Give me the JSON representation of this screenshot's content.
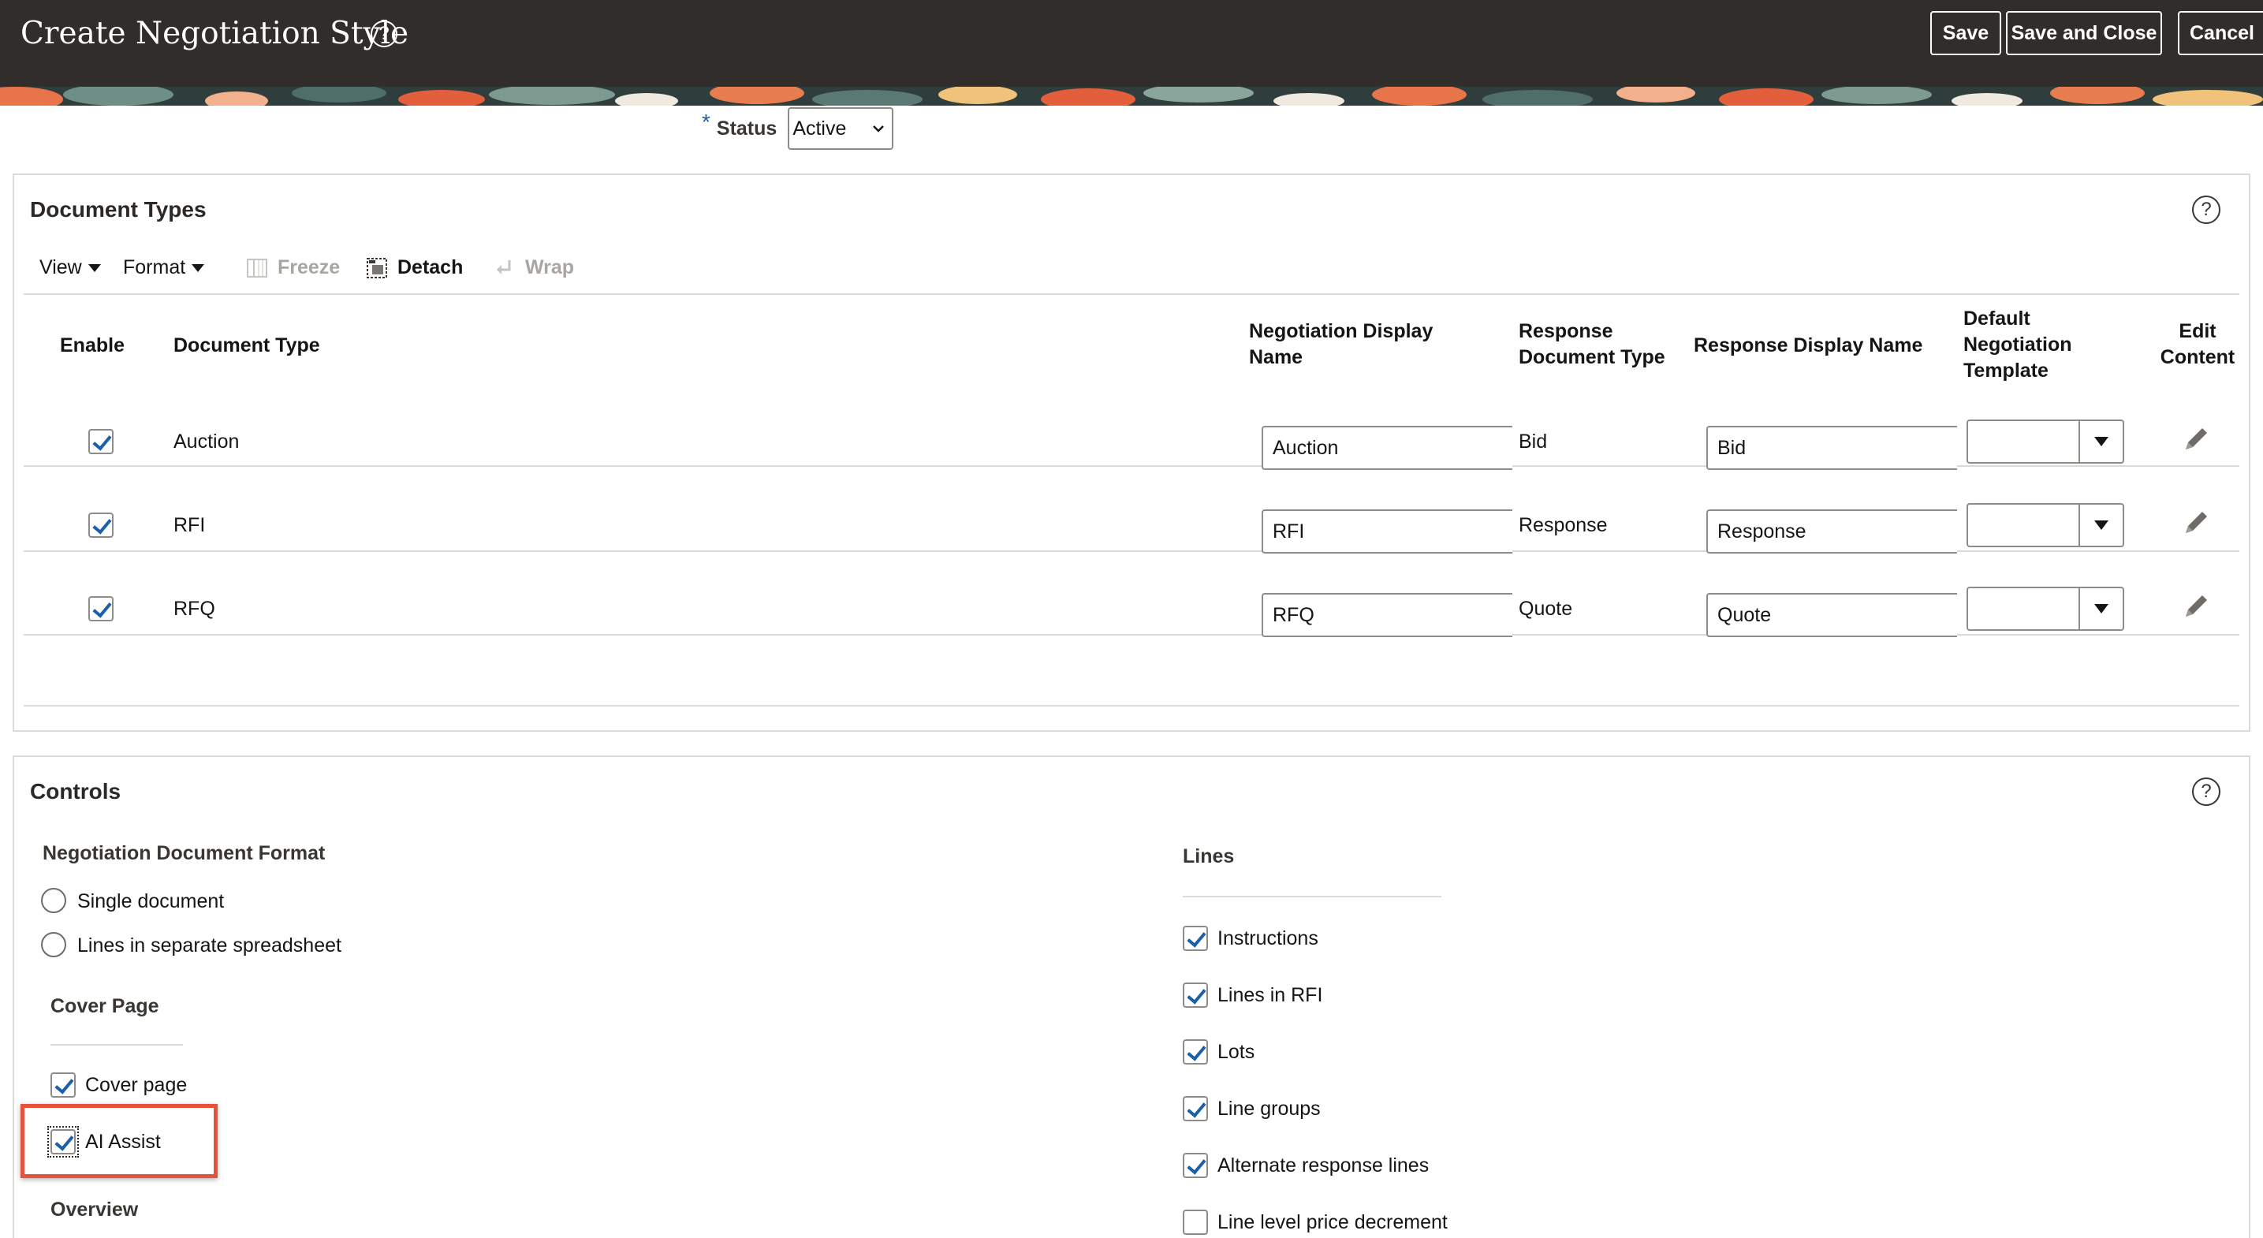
{
  "header": {
    "title": "Create Negotiation Style",
    "help_icon": "question-circle-icon",
    "buttons": {
      "save": "Save",
      "save_and_close": "Save and Close",
      "cancel": "Cancel"
    }
  },
  "status": {
    "required_marker": "*",
    "label": "Status",
    "value": "Active"
  },
  "document_types": {
    "title": "Document Types",
    "toolbar": {
      "view": "View",
      "format": "Format",
      "freeze": "Freeze",
      "detach": "Detach",
      "wrap": "Wrap"
    },
    "columns": {
      "enable": "Enable",
      "document_type": "Document Type",
      "negotiation_display_name": "Negotiation Display Name",
      "response_document_type": "Response Document Type",
      "response_display_name": "Response Display Name",
      "default_negotiation_template": "Default Negotiation Template",
      "edit_content": "Edit Content"
    },
    "rows": [
      {
        "enabled": true,
        "document_type": "Auction",
        "negotiation_display_name": "Auction",
        "response_document_type": "Bid",
        "response_display_name": "Bid",
        "default_template": ""
      },
      {
        "enabled": true,
        "document_type": "RFI",
        "negotiation_display_name": "RFI",
        "response_document_type": "Response",
        "response_display_name": "Response",
        "default_template": ""
      },
      {
        "enabled": true,
        "document_type": "RFQ",
        "negotiation_display_name": "RFQ",
        "response_document_type": "Quote",
        "response_display_name": "Quote",
        "default_template": ""
      }
    ]
  },
  "controls": {
    "title": "Controls",
    "negotiation_document_format": {
      "heading": "Negotiation Document Format",
      "options": [
        {
          "label": "Single document",
          "selected": false
        },
        {
          "label": "Lines in separate spreadsheet",
          "selected": false
        }
      ]
    },
    "cover_page": {
      "heading": "Cover Page",
      "options": [
        {
          "label": "Cover page",
          "checked": true
        },
        {
          "label": "AI Assist",
          "checked": true
        }
      ]
    },
    "overview": {
      "heading": "Overview"
    },
    "lines": {
      "heading": "Lines",
      "options": [
        {
          "label": "Instructions",
          "checked": true
        },
        {
          "label": "Lines in RFI",
          "checked": true
        },
        {
          "label": "Lots",
          "checked": true
        },
        {
          "label": "Line groups",
          "checked": true
        },
        {
          "label": "Alternate response lines",
          "checked": true
        },
        {
          "label": "Line level price decrement",
          "checked": false
        }
      ]
    }
  },
  "colors": {
    "header_bg": "#312d2a",
    "accent": "#1b5fa8",
    "highlight": "#e5533d"
  }
}
